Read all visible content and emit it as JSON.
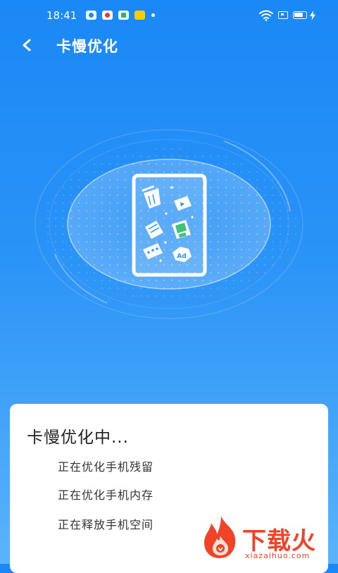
{
  "status_bar": {
    "time": "18:41",
    "icons": [
      "app-notification-icon",
      "app-notification-icon",
      "app-notification-icon",
      "app-notification-icon",
      "more-dot-icon",
      "wifi-icon",
      "cast-icon",
      "battery-icon",
      "charging-icon"
    ]
  },
  "header": {
    "title": "卡慢优化",
    "back_icon": "back-chevron-icon"
  },
  "scan": {
    "illustration_icons": [
      "trash-icon",
      "video-file-icon",
      "image-file-icon",
      "document-icon",
      "chat-icon",
      "ad-icon"
    ],
    "ad_badge": "Ad"
  },
  "progress_card": {
    "title": "卡慢优化中...",
    "tasks": [
      "正在优化手机残留",
      "正在优化手机内存",
      "正在释放手机空间"
    ]
  },
  "watermark": {
    "brand": "下载火",
    "site": "xiazaihuo.com"
  },
  "colors": {
    "background_top": "#1a88f6",
    "background_bottom": "#5bb3fb",
    "card": "#ffffff",
    "watermark": "#f04428"
  }
}
